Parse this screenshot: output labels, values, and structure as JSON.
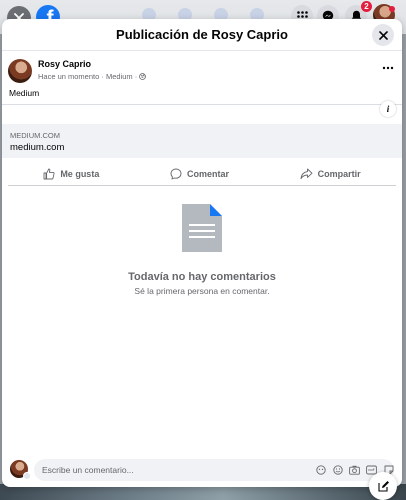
{
  "topbar": {
    "close_icon": "close-icon",
    "logo_letter": "f",
    "notification_count": "2"
  },
  "dialog": {
    "title": "Publicación de Rosy Caprio"
  },
  "post": {
    "author": "Rosy Caprio",
    "meta": "Hace un momento · Medium ·",
    "text": "Medium",
    "link": {
      "domain": "MEDIUM.COM",
      "title": "medium.com"
    }
  },
  "actions": {
    "like": "Me gusta",
    "comment": "Comentar",
    "share": "Compartir"
  },
  "comments": {
    "empty_title": "Todavía no hay comentarios",
    "empty_subtitle": "Sé la primera persona en comentar."
  },
  "composer": {
    "placeholder": "Escribe un comentario..."
  },
  "colors": {
    "brand": "#1877f2",
    "notification": "#e41e3f",
    "secondary_text": "#65676b"
  }
}
